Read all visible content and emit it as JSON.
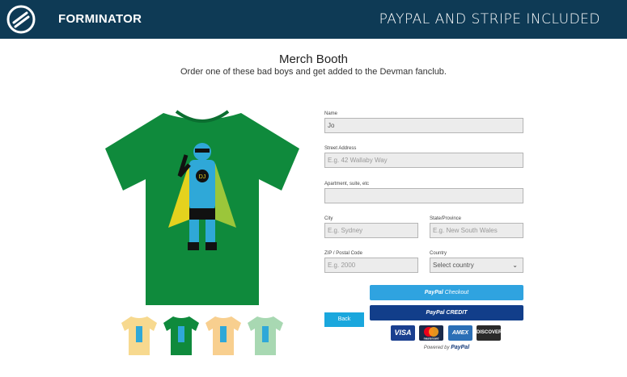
{
  "header": {
    "brand": "FORMINATOR",
    "tagline": "PAYPAL AND STRIPE INCLUDED",
    "colors": {
      "background": "#0e3a55",
      "text": "#ffffff"
    }
  },
  "intro": {
    "title": "Merch Booth",
    "subtitle": "Order one of these bad boys and get added to the Devman fanclub."
  },
  "product": {
    "main_shirt_color": "#0f8a3c",
    "thumbnails": [
      {
        "color": "#f7d98f"
      },
      {
        "color": "#0f8a3c"
      },
      {
        "color": "#f8cf8f"
      },
      {
        "color": "#a8d8b2"
      }
    ]
  },
  "form": {
    "name": {
      "label": "Name",
      "value": "Jo"
    },
    "street": {
      "label": "Street Address",
      "placeholder": "E.g. 42 Wallaby Way"
    },
    "apartment": {
      "label": "Apartment, suite, etc",
      "value": ""
    },
    "city": {
      "label": "City",
      "placeholder": "E.g. Sydney"
    },
    "state": {
      "label": "State/Province",
      "placeholder": "E.g. New South Wales"
    },
    "zip": {
      "label": "ZIP / Postal Code",
      "placeholder": "E.g. 2000"
    },
    "country": {
      "label": "Country",
      "value": "Select country"
    }
  },
  "buttons": {
    "paypal_checkout_brand": "PayPal",
    "paypal_checkout_text": "Checkout",
    "paypal_credit_brand": "PayPal",
    "paypal_credit_text": "CREDIT",
    "back": "Back"
  },
  "cards": {
    "visa": "VISA",
    "mastercard": "mastercard",
    "amex": "AMEX",
    "discover": "DISCOVER"
  },
  "powered": {
    "prefix": "Powered by",
    "brand": "PayPal"
  }
}
